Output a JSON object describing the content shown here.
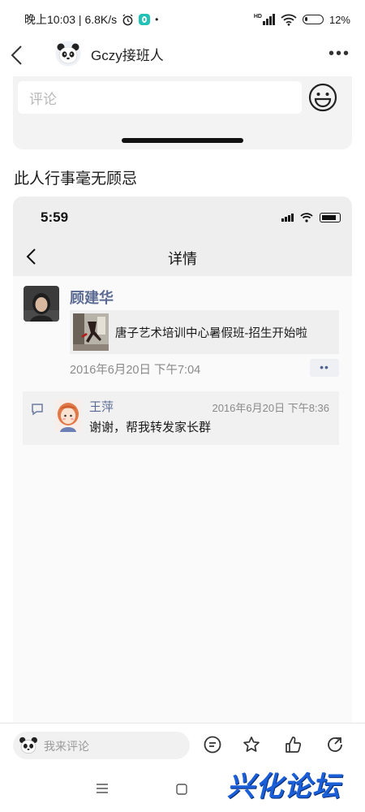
{
  "status_bar": {
    "time_speed": "晚上10:03 | 6.8K/s",
    "battery": "12%",
    "network_badge": "HD"
  },
  "header": {
    "username": "Gczy接班人",
    "more": "•••"
  },
  "comment_box": {
    "placeholder": "评论"
  },
  "post": {
    "caption": "此人行事毫无顾忌"
  },
  "screenshot": {
    "time": "5:59",
    "nav_title": "详情",
    "author": "顾建华",
    "link_title": "唐子艺术培训中心暑假班-招生开始啦",
    "timestamp": "2016年6月20日 下午7:04",
    "more": "••",
    "reply": {
      "author": "王萍",
      "timestamp": "2016年6月20日 下午8:36",
      "text": "谢谢，帮我转发家长群"
    }
  },
  "bottom_bar": {
    "placeholder": "我来评论"
  },
  "watermark": "兴化论坛",
  "colors": {
    "author_blue": "#5a6a92",
    "card_gray": "#f3f3f3",
    "watermark_blue": "#1a5fd8"
  }
}
